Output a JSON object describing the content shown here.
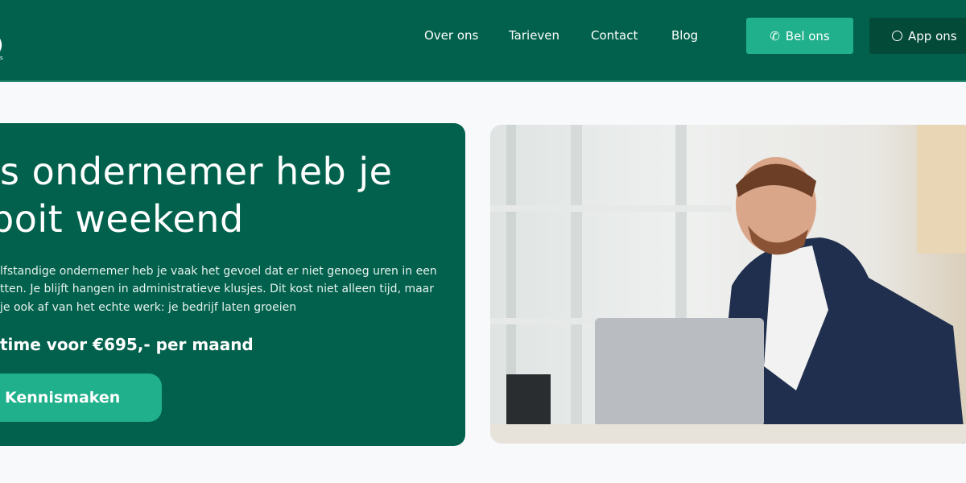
{
  "header": {
    "logo_text": "",
    "nav": [
      "Over ons",
      "Tarieven",
      "Contact",
      "Blog"
    ],
    "call_button": "Bel ons",
    "whatsapp_button": "App ons"
  },
  "hero": {
    "title_line1": "s ondernemer heb je",
    "title_line2": "boit weekend",
    "body_line1": "lfstandige ondernemer heb je vaak het gevoel dat er niet genoeg uren in een",
    "body_line2": "tten. Je blijft hangen in administratieve klusjes. Dit kost niet alleen tijd, maar",
    "body_line3": "je ook af van het echte werk: je bedrijf laten groeien",
    "price": "time voor €695,- per maand",
    "cta": "Kennismaken"
  },
  "colors": {
    "brand": "#01614c",
    "accent": "#20b08b",
    "dark": "#034a38"
  }
}
